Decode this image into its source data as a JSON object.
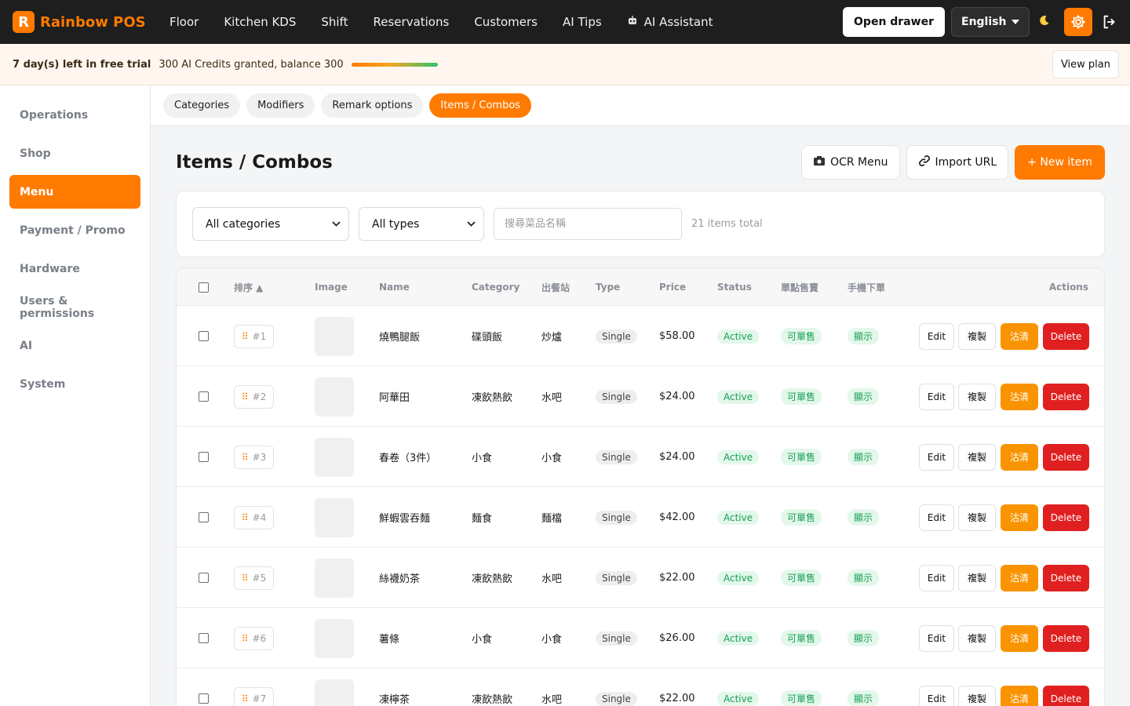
{
  "brand": {
    "logo_letter": "R",
    "name": "Rainbow POS",
    "accent": "#ff7a00"
  },
  "nav": {
    "links": [
      "Floor",
      "Kitchen KDS",
      "Shift",
      "Reservations",
      "Customers",
      "AI Tips",
      "AI Assistant"
    ],
    "open_drawer": "Open drawer",
    "language": "English",
    "icons": {
      "theme": "moon-icon",
      "settings": "gear-icon",
      "logout": "logout-icon",
      "assistant": "robot-icon"
    }
  },
  "trial": {
    "days_left": "7 day(s) left in free trial",
    "credits": "300 AI Credits granted, balance 300",
    "credits_fraction": 1.0,
    "view_plan": "View plan"
  },
  "sidebar": {
    "items": [
      {
        "label": "Operations",
        "active": false
      },
      {
        "label": "Shop",
        "active": false
      },
      {
        "label": "Menu",
        "active": true
      },
      {
        "label": "Payment / Promo",
        "active": false
      },
      {
        "label": "Hardware",
        "active": false
      },
      {
        "label": "Users & permissions",
        "active": false
      },
      {
        "label": "AI",
        "active": false
      },
      {
        "label": "System",
        "active": false
      }
    ]
  },
  "subtabs": [
    {
      "label": "Categories",
      "active": false
    },
    {
      "label": "Modifiers",
      "active": false
    },
    {
      "label": "Remark options",
      "active": false
    },
    {
      "label": "Items / Combos",
      "active": true
    }
  ],
  "page": {
    "title": "Items / Combos",
    "ocr_menu": "OCR Menu",
    "import_url": "Import URL",
    "new_item": "+ New item"
  },
  "filters": {
    "category": "All categories",
    "type": "All types",
    "search_placeholder": "搜尋菜品名稱",
    "total": "21 items total"
  },
  "table": {
    "headers": {
      "order": "排序 ▲",
      "image": "Image",
      "name": "Name",
      "category": "Category",
      "station": "出餐站",
      "type": "Type",
      "price": "Price",
      "status": "Status",
      "single_sale": "單點售賣",
      "mobile_order": "手機下單",
      "actions": "Actions"
    },
    "actions": {
      "edit": "Edit",
      "copy": "複製",
      "clear": "沽清",
      "delete": "Delete"
    },
    "rows": [
      {
        "order": "#1",
        "name": "燒鴨腿飯",
        "category": "碟頭飯",
        "station": "炒爐",
        "type": "Single",
        "price": "$58.00",
        "status": "Active",
        "single_sale": "可單售",
        "mobile_order": "顯示"
      },
      {
        "order": "#2",
        "name": "阿華田",
        "category": "凍飲熱飲",
        "station": "水吧",
        "type": "Single",
        "price": "$24.00",
        "status": "Active",
        "single_sale": "可單售",
        "mobile_order": "顯示"
      },
      {
        "order": "#3",
        "name": "春卷（3件）",
        "category": "小食",
        "station": "小食",
        "type": "Single",
        "price": "$24.00",
        "status": "Active",
        "single_sale": "可單售",
        "mobile_order": "顯示"
      },
      {
        "order": "#4",
        "name": "鮮蝦雲吞麵",
        "category": "麵食",
        "station": "麵檔",
        "type": "Single",
        "price": "$42.00",
        "status": "Active",
        "single_sale": "可單售",
        "mobile_order": "顯示"
      },
      {
        "order": "#5",
        "name": "絲襪奶茶",
        "category": "凍飲熱飲",
        "station": "水吧",
        "type": "Single",
        "price": "$22.00",
        "status": "Active",
        "single_sale": "可單售",
        "mobile_order": "顯示"
      },
      {
        "order": "#6",
        "name": "薯條",
        "category": "小食",
        "station": "小食",
        "type": "Single",
        "price": "$26.00",
        "status": "Active",
        "single_sale": "可單售",
        "mobile_order": "顯示"
      },
      {
        "order": "#7",
        "name": "凍檸茶",
        "category": "凍飲熱飲",
        "station": "水吧",
        "type": "Single",
        "price": "$22.00",
        "status": "Active",
        "single_sale": "可單售",
        "mobile_order": "顯示"
      }
    ]
  }
}
